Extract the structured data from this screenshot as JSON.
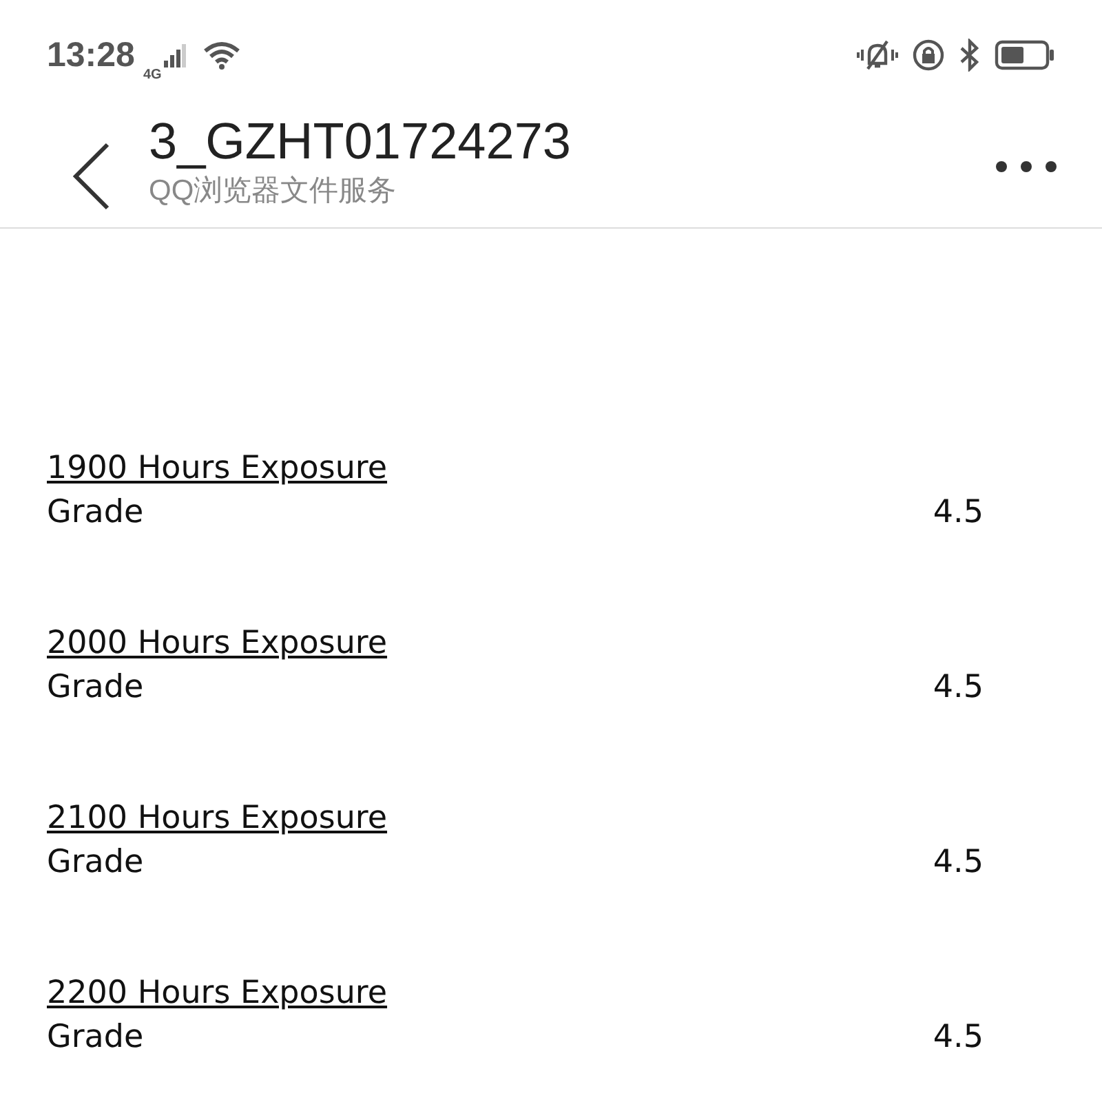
{
  "status_bar": {
    "time": "13:28",
    "network": "4G"
  },
  "header": {
    "title": "3_GZHT01724273",
    "subtitle": "QQ浏览器文件服务"
  },
  "sections": [
    {
      "heading": "1900 Hours Exposure",
      "label": "Grade",
      "value": "4.5"
    },
    {
      "heading": "2000 Hours Exposure",
      "label": "Grade",
      "value": "4.5"
    },
    {
      "heading": "2100 Hours Exposure",
      "label": "Grade",
      "value": "4.5"
    },
    {
      "heading": "2200 Hours Exposure",
      "label": "Grade",
      "value": "4.5"
    }
  ]
}
